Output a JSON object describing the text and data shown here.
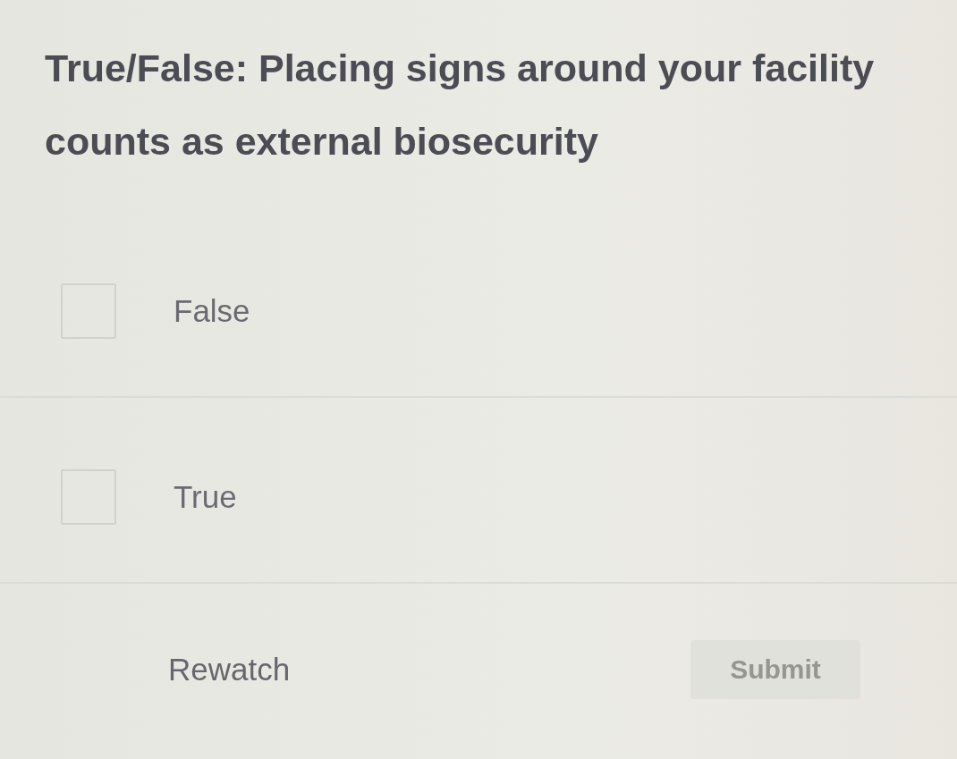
{
  "question": {
    "text": "True/False: Placing signs around your facility counts as external biosecurity"
  },
  "options": [
    {
      "label": "False",
      "checked": false
    },
    {
      "label": "True",
      "checked": false
    }
  ],
  "buttons": [
    {
      "label": "Rewatch",
      "kind": "text",
      "disabled": false
    },
    {
      "label": "Submit",
      "kind": "primary",
      "disabled": true
    }
  ]
}
